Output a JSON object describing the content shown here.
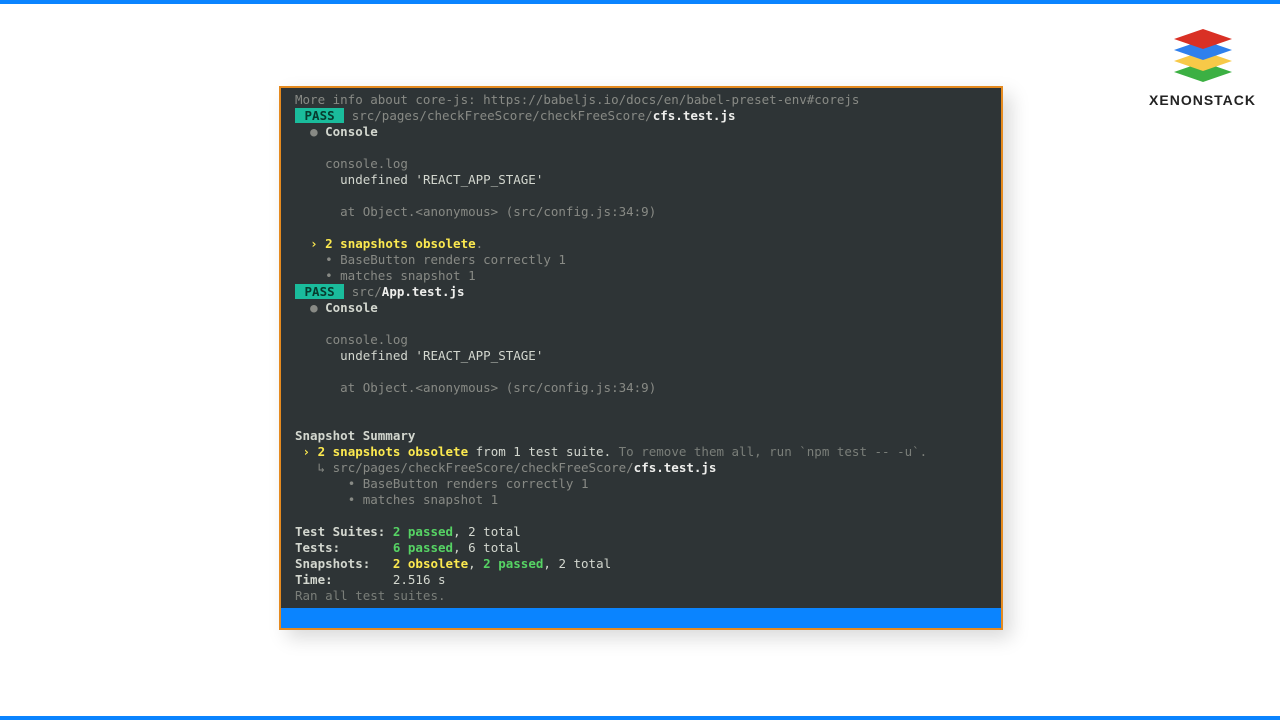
{
  "brand": {
    "name": "XENONSTACK"
  },
  "terminal": {
    "more_info": "More info about core-js: https://babeljs.io/docs/en/babel-preset-env#corejs",
    "pass1": {
      "badge": " PASS ",
      "pathPrefix": "src/pages/checkFreeScore/checkFreeScore/",
      "pathBold": "cfs.test.js"
    },
    "console_label": "Console",
    "console_log": "console.log",
    "undef_line": "undefined 'REACT_APP_STAGE'",
    "at_line": "at Object.<anonymous> (src/config.js:34:9)",
    "obs_prefix": "› ",
    "obs_count": "2 snapshots obsolete",
    "obs_dot": ".",
    "snap_item1": "• BaseButton renders correctly 1",
    "snap_item2": "• matches snapshot 1",
    "pass2": {
      "badge": " PASS ",
      "pathPrefix": "src/",
      "pathBold": "App.test.js"
    },
    "summary_header": "Snapshot Summary",
    "sum_after": "from 1 test suite.",
    "sum_hint": "To remove them all, run `npm test -- -u`.",
    "tree_char": "↳ ",
    "tree_pathPrefix": "src/pages/checkFreeScore/checkFreeScore/",
    "tree_pathBold": "cfs.test.js",
    "results": {
      "suites_label": "Test Suites: ",
      "suites_passed": "2 passed",
      "suites_total": ", 2 total",
      "tests_label": "Tests:       ",
      "tests_passed": "6 passed",
      "tests_total": ", 6 total",
      "snaps_label": "Snapshots:   ",
      "snaps_obs": "2 obsolete",
      "snaps_sep": ", ",
      "snaps_passed": "2 passed",
      "snaps_total": ", 2 total",
      "time_label": "Time:        ",
      "time_value": "2.516 s"
    },
    "ran_all": "Ran all test suites."
  }
}
